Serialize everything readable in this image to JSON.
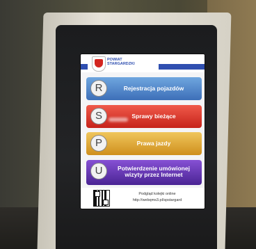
{
  "kiosk": {
    "org_line1": "POWIAT",
    "org_line2": "STARGARDZKI",
    "header_small": "",
    "menu": [
      {
        "letter": "R",
        "label": "Rejestracja pojazdów",
        "color": "#4f82c8"
      },
      {
        "letter": "S",
        "label": "Sprawy bieżące",
        "color": "#d8322a"
      },
      {
        "letter": "P",
        "label": "Prawa jazdy",
        "color": "#e0a832"
      },
      {
        "letter": "U",
        "label": "Potwierdzenie umówionej wizyty przez Internet",
        "color": "#5f34ae"
      }
    ],
    "footer_line1": "Podgląd kolejki online",
    "footer_line2": "http://webqms3.pl/spstargard"
  },
  "colors": {
    "accent": "#2f4fb0"
  }
}
